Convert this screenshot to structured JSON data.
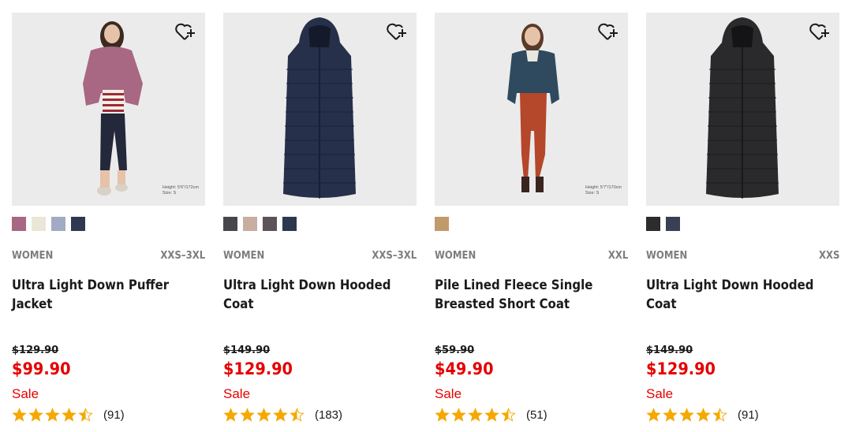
{
  "favorite_icon": "heart-plus-icon",
  "star_color": "#f5a800",
  "sale_color": "#e60000",
  "products": [
    {
      "image_caption_height": "Height: 5'6\"/172cm",
      "image_caption_size": "Size: S",
      "colors": [
        "#a86782",
        "#ece6d7",
        "#a1abc3",
        "#2f3850"
      ],
      "gender": "WOMEN",
      "size_range": "XXS–3XL",
      "name": "Ultra Light Down Puffer Jacket",
      "original_price": "$129.90",
      "sale_price": "$99.90",
      "sale_label": "Sale",
      "rating": 4.5,
      "review_count": "(91)"
    },
    {
      "image_caption_height": "",
      "image_caption_size": "",
      "colors": [
        "#45474c",
        "#c9ad9f",
        "#5e5257",
        "#2b3850"
      ],
      "gender": "WOMEN",
      "size_range": "XXS–3XL",
      "name": "Ultra Light Down Hooded Coat",
      "original_price": "$149.90",
      "sale_price": "$129.90",
      "sale_label": "Sale",
      "rating": 4.5,
      "review_count": "(183)"
    },
    {
      "image_caption_height": "Height: 5'7\"/170cm",
      "image_caption_size": "Size: S",
      "colors": [
        "#c19a6b"
      ],
      "gender": "WOMEN",
      "size_range": "XXL",
      "name": "Pile Lined Fleece Single Breasted Short Coat",
      "original_price": "$59.90",
      "sale_price": "$49.90",
      "sale_label": "Sale",
      "rating": 4.5,
      "review_count": "(51)"
    },
    {
      "image_caption_height": "",
      "image_caption_size": "",
      "colors": [
        "#2c2c2c",
        "#3b3f55"
      ],
      "gender": "WOMEN",
      "size_range": "XXS",
      "name": "Ultra Light Down Hooded Coat",
      "original_price": "$149.90",
      "sale_price": "$129.90",
      "sale_label": "Sale",
      "rating": 4.5,
      "review_count": "(91)"
    }
  ]
}
